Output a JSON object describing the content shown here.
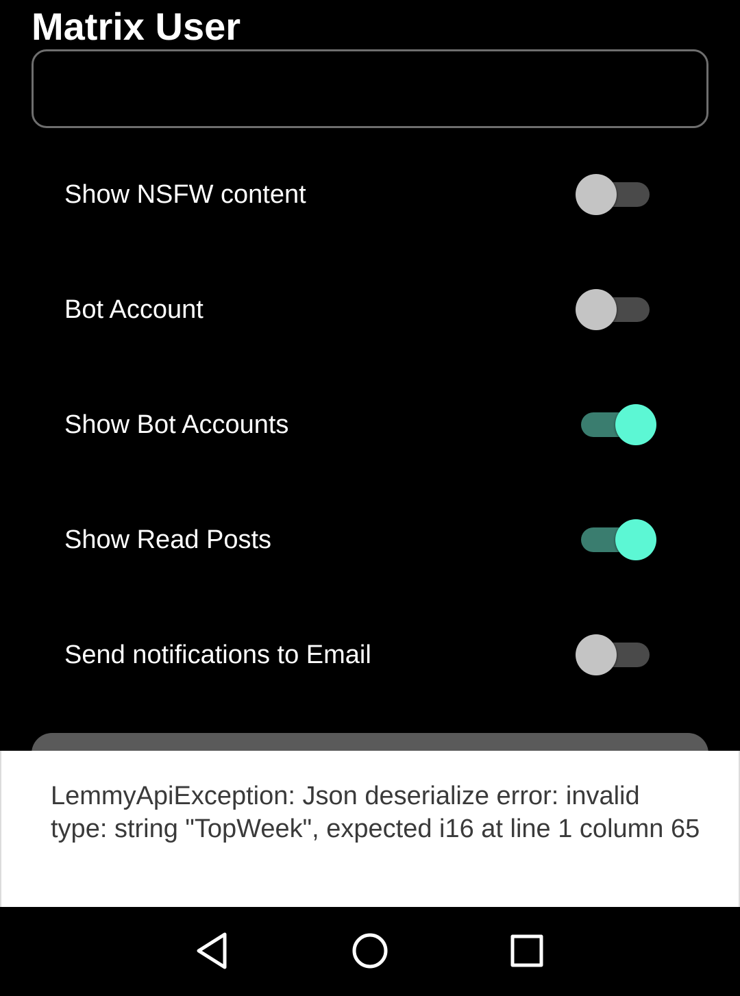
{
  "matrix": {
    "label": "Matrix User",
    "value": "",
    "placeholder": ""
  },
  "settings": [
    {
      "label": "Show NSFW content",
      "checked": false
    },
    {
      "label": "Bot Account",
      "checked": false
    },
    {
      "label": "Show Bot Accounts",
      "checked": true
    },
    {
      "label": "Show Read Posts",
      "checked": true
    },
    {
      "label": "Send notifications to Email",
      "checked": false
    }
  ],
  "snackbar": {
    "message": "LemmyApiException: Json deserialize error: invalid type: string \"TopWeek\", expected i16 at line 1 column 65"
  },
  "nav": {
    "back_icon": "triangle-back-icon",
    "home_icon": "circle-home-icon",
    "recent_icon": "square-recents-icon"
  },
  "colors": {
    "background": "#000000",
    "switch_on_thumb": "#5cf7d4",
    "switch_on_track": "#3a7d6f",
    "switch_off_thumb": "#c4c4c4",
    "switch_off_track": "#4a4a4a",
    "snackbar_bg": "#ffffff"
  }
}
